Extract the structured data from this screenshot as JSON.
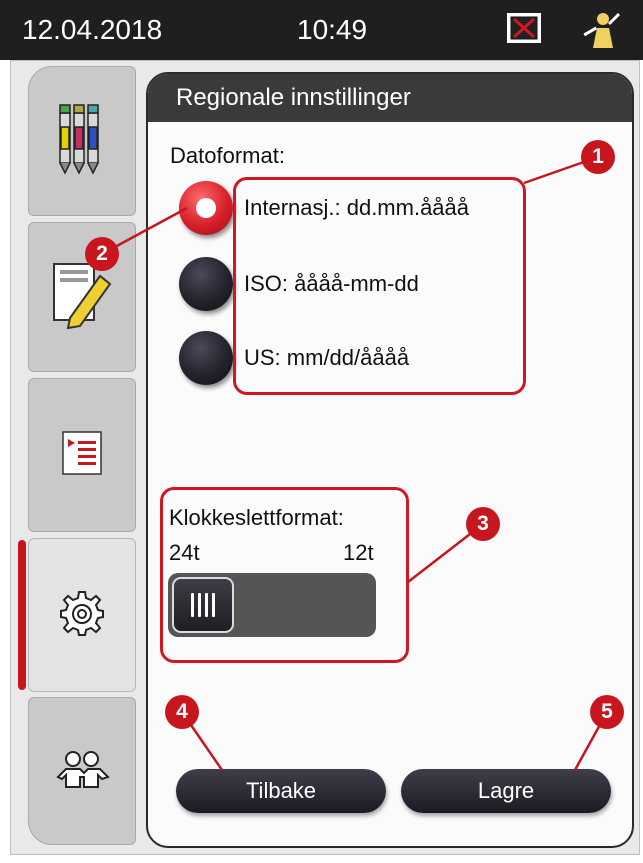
{
  "status_bar": {
    "date": "12.04.2018",
    "time": "10:49",
    "error_icon": "error-x-icon",
    "user_icon": "user-supervisor-icon"
  },
  "sidebar": {
    "tabs": [
      {
        "icon": "reagents-icon",
        "active": false
      },
      {
        "icon": "edit-program-icon",
        "active": false
      },
      {
        "icon": "program-list-icon",
        "active": false
      },
      {
        "icon": "settings-gear-icon",
        "active": true
      },
      {
        "icon": "users-icon",
        "active": false
      }
    ]
  },
  "panel": {
    "title": "Regionale innstillinger",
    "date_format_label": "Datoformat:",
    "date_options": [
      {
        "label": "Internasj.: dd.mm.åååå",
        "selected": true
      },
      {
        "label": "ISO: åååå-mm-dd",
        "selected": false
      },
      {
        "label": "US: mm/dd/åååå",
        "selected": false
      }
    ],
    "time_format_label": "Klokkeslettformat:",
    "time_option_left": "24t",
    "time_option_right": "12t",
    "time_format_selected": "24t",
    "back_label": "Tilbake",
    "save_label": "Lagre"
  },
  "callouts": [
    "1",
    "2",
    "3",
    "4",
    "5"
  ],
  "colors": {
    "accent_red": "#c8161f",
    "header_dark": "#3a3a3a",
    "status_bar": "#1f1f1f"
  }
}
